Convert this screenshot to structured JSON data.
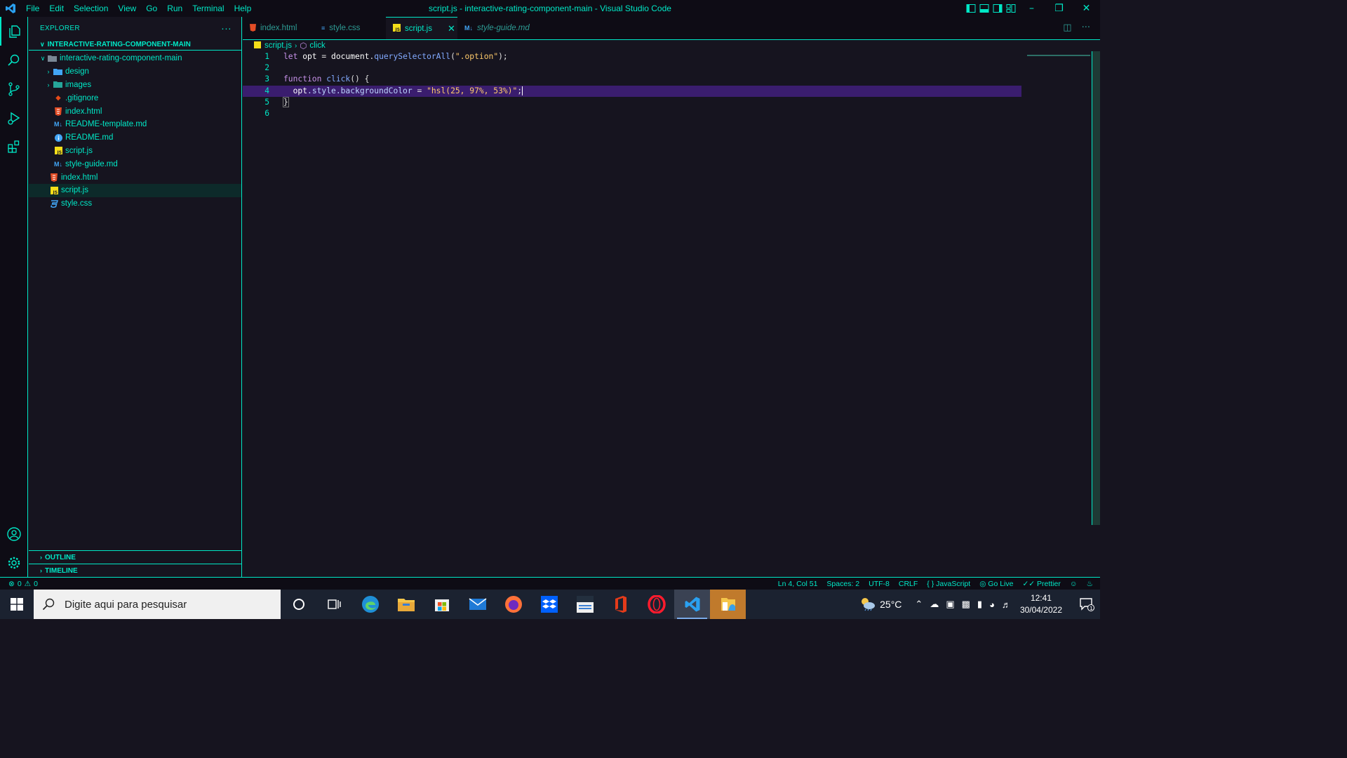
{
  "titlebar": {
    "menu": [
      "File",
      "Edit",
      "Selection",
      "View",
      "Go",
      "Run",
      "Terminal",
      "Help"
    ],
    "title": "script.js - interactive-rating-component-main - Visual Studio Code"
  },
  "sidebar": {
    "header": "EXPLORER",
    "root": "INTERACTIVE-RATING-COMPONENT-MAIN",
    "folder": "interactive-rating-component-main",
    "items": [
      {
        "label": "design",
        "type": "folder",
        "icon_color": "#42a5f5"
      },
      {
        "label": "images",
        "type": "folder",
        "icon_color": "#26a69a"
      },
      {
        "label": ".gitignore",
        "type": "git",
        "icon_color": "#e64a19"
      },
      {
        "label": "index.html",
        "type": "html",
        "icon_color": "#e44d26"
      },
      {
        "label": "README-template.md",
        "type": "md",
        "icon_color": "#42a5f5"
      },
      {
        "label": "README.md",
        "type": "info",
        "icon_color": "#42a5f5"
      },
      {
        "label": "script.js",
        "type": "js",
        "icon_color": "#f5de19"
      },
      {
        "label": "style-guide.md",
        "type": "md",
        "icon_color": "#42a5f5"
      }
    ],
    "root_files": [
      {
        "label": "index.html",
        "type": "html"
      },
      {
        "label": "script.js",
        "type": "js"
      },
      {
        "label": "style.css",
        "type": "css"
      }
    ],
    "outline": "OUTLINE",
    "timeline": "TIMELINE"
  },
  "tabs": [
    {
      "label": "index.html",
      "type": "html"
    },
    {
      "label": "style.css",
      "type": "css"
    },
    {
      "label": "script.js",
      "type": "js"
    },
    {
      "label": "style-guide.md",
      "type": "md"
    }
  ],
  "breadcrumb": {
    "file": "script.js",
    "symbol": "click"
  },
  "editor": {
    "line_numbers": [
      "1",
      "2",
      "3",
      "4",
      "5",
      "6"
    ],
    "line1": {
      "kw": "let",
      "var": " opt ",
      "eq": "= ",
      "obj": "document",
      "dot": ".",
      "fn": "querySelectorAll",
      "open": "(",
      "str": "\".option\"",
      "close": ");"
    },
    "line3": {
      "kw": "function",
      "fn": " click",
      "paren": "()",
      "brace": " {"
    },
    "line4": {
      "obj": "  opt",
      "p1": ".style.",
      "prop": "backgroundColor",
      "eq": " = ",
      "str": "\"hsl(25, 97%, 53%)\"",
      "end": ";"
    },
    "line5": {
      "brace": "}"
    }
  },
  "statusbar": {
    "errors": "0",
    "warnings": "0",
    "position": "Ln 4, Col 51",
    "spaces": "Spaces: 2",
    "encoding": "UTF-8",
    "eol": "CRLF",
    "language": "JavaScript",
    "golive": "Go Live",
    "prettier": "Prettier"
  },
  "taskbar": {
    "search_placeholder": "Digite aqui para pesquisar",
    "temperature": "25°C",
    "time": "12:41",
    "date": "30/04/2022",
    "notifications": "1"
  },
  "colors": {
    "accent": "#00e8c6",
    "background": "#16141f",
    "current_line": "#3a1d6e"
  }
}
